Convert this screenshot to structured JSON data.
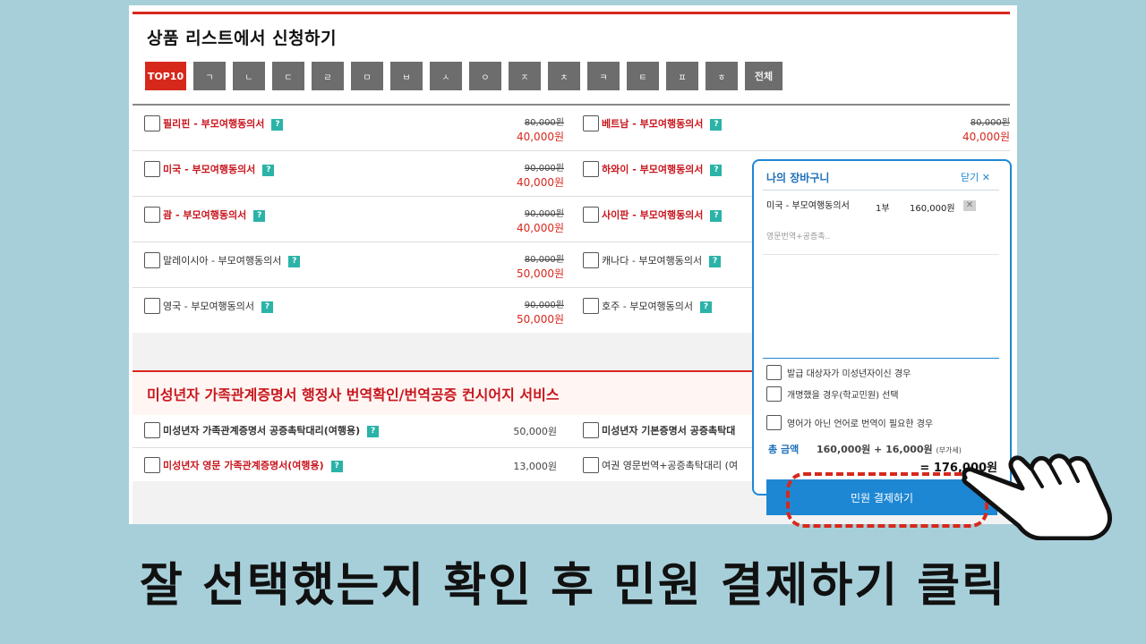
{
  "section_title": "상품 리스트에서 신청하기",
  "tabs": [
    "TOP10",
    "ㄱ",
    "ㄴ",
    "ㄷ",
    "ㄹ",
    "ㅁ",
    "ㅂ",
    "ㅅ",
    "ㅇ",
    "ㅈ",
    "ㅊ",
    "ㅋ",
    "ㅌ",
    "ㅍ",
    "ㅎ",
    "전체"
  ],
  "products": [
    {
      "left": {
        "name": "필리핀 - 부모여행동의서",
        "old": "80,000원",
        "new": "40,000원"
      },
      "right": {
        "name": "베트남 - 부모여행동의서",
        "old": "80,000원",
        "new": "40,000원"
      }
    },
    {
      "left": {
        "name": "미국 - 부모여행동의서",
        "old": "90,000원",
        "new": "40,000원"
      },
      "right": {
        "name": "하와이 - 부모여행동의서",
        "old": "",
        "new": ""
      }
    },
    {
      "left": {
        "name": "괌 - 부모여행동의서",
        "old": "90,000원",
        "new": "40,000원"
      },
      "right": {
        "name": "사이판 - 부모여행동의서",
        "old": "",
        "new": ""
      }
    },
    {
      "left": {
        "name": "말레이시아 - 부모여행동의서",
        "old": "80,000원",
        "new": "50,000원"
      },
      "right": {
        "name": "캐나다 - 부모여행동의서",
        "old": "",
        "new": ""
      }
    },
    {
      "left": {
        "name": "영국 - 부모여행동의서",
        "old": "90,000원",
        "new": "50,000원"
      },
      "right": {
        "name": "호주 - 부모여행동의서",
        "old": "",
        "new": ""
      }
    }
  ],
  "section2_title": "미성년자 가족관계증명서 행정사 번역확인/번역공증 컨시어지 서비스",
  "products2": [
    {
      "left": {
        "name": "미성년자 가족관계증명서 공증촉탁대리(여행용)",
        "price": "50,000원"
      },
      "right": {
        "name": "미성년자 기본증명서 공증촉탁대"
      }
    },
    {
      "left": {
        "name": "미성년자 영문 가족관계증명서(여행용)",
        "price": "13,000원"
      },
      "right": {
        "name": "여권 영문번역+공증촉탁대리 (여"
      }
    }
  ],
  "help_label": "?",
  "cart": {
    "title": "나의 장바구니",
    "close": "닫기 ✕",
    "item": {
      "name": "미국 - 부모여행동의서",
      "qty": "1부",
      "price": "160,000원",
      "option": "영문번역+공증촉.."
    },
    "options": [
      "발급 대상자가 미성년자이신 경우",
      "개명했을 경우(학교민원) 선택",
      "영어가 아닌 언어로 번역이 필요한 경우"
    ],
    "total_label": "총 금액",
    "total_calc": "160,000원 + 16,000원",
    "vat": "(부가세)",
    "total_result": "= 176,000원",
    "pay_button": "민원 결제하기"
  },
  "caption": "잘 선택했는지 확인 후 민원 결제하기 클릭"
}
